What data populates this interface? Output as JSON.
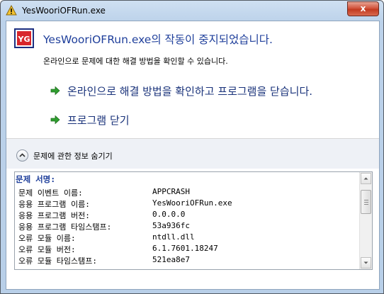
{
  "window": {
    "title": "YesWooriOFRun.exe",
    "close_label": "x"
  },
  "app_logo_text": "YG",
  "headline": "YesWooriOFRun.exe의 작동이 중지되었습니다.",
  "subline": "온라인으로 문제에 대한 해결 방법을 확인할 수 있습니다.",
  "commands": [
    {
      "label": "온라인으로 해결 방법을 확인하고 프로그램을 닫습니다.",
      "icon": "green-arrow-icon"
    },
    {
      "label": "프로그램 닫기",
      "icon": "green-arrow-icon"
    }
  ],
  "details_toggle": {
    "label": "문제에 관한 정보 숨기기",
    "icon": "chevron-up-icon"
  },
  "problem_signature": {
    "title": "문제 서명:",
    "rows": [
      {
        "label": "문제 이벤트 이름:",
        "value": "APPCRASH"
      },
      {
        "label": "응용 프로그램 이름:",
        "value": "YesWooriOFRun.exe"
      },
      {
        "label": "응용 프로그램 버전:",
        "value": "0.0.0.0"
      },
      {
        "label": "응용 프로그램 타임스탬프:",
        "value": "53a936fc"
      },
      {
        "label": "오류 모듈 이름:",
        "value": "ntdll.dll"
      },
      {
        "label": "오류 모듈 버전:",
        "value": "6.1.7601.18247"
      },
      {
        "label": "오류 모듈 타임스탬프:",
        "value": "521ea8e7"
      }
    ]
  },
  "colors": {
    "headline": "#1f3f9b",
    "command_text": "#19327a",
    "arrow_green": "#2f9e2f",
    "close_red": "#c23a20"
  }
}
